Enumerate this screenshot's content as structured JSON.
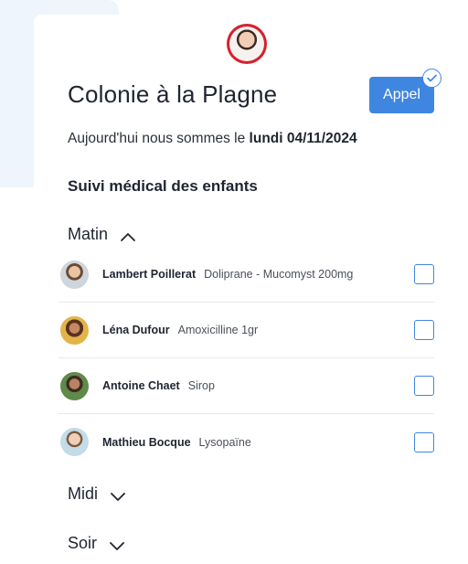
{
  "header": {
    "title": "Colonie à la Plagne",
    "appel_label": "Appel"
  },
  "date": {
    "prefix": "Aujourd'hui nous sommes le",
    "value": "lundi 04/11/2024"
  },
  "section": {
    "title": "Suivi médical des enfants"
  },
  "periods": {
    "matin": "Matin",
    "midi": "Midi",
    "soir": "Soir"
  },
  "matin_rows": [
    {
      "name": "Lambert Poillerat",
      "medication": "Doliprane - Mucomyst 200mg",
      "checked": false
    },
    {
      "name": "Léna Dufour",
      "medication": "Amoxicilline 1gr",
      "checked": false
    },
    {
      "name": "Antoine Chaet",
      "medication": "Sirop",
      "checked": false
    },
    {
      "name": "Mathieu Bocque",
      "medication": "Lysopaïne",
      "checked": false
    }
  ],
  "colors": {
    "accent": "#3f86e0",
    "background_shape": "#eef5fc",
    "avatar_ring": "#d81f2c"
  },
  "icons": {
    "check_badge": "check-icon",
    "matin_toggle": "chevron-up-icon",
    "midi_toggle": "chevron-down-icon",
    "soir_toggle": "chevron-down-icon"
  }
}
